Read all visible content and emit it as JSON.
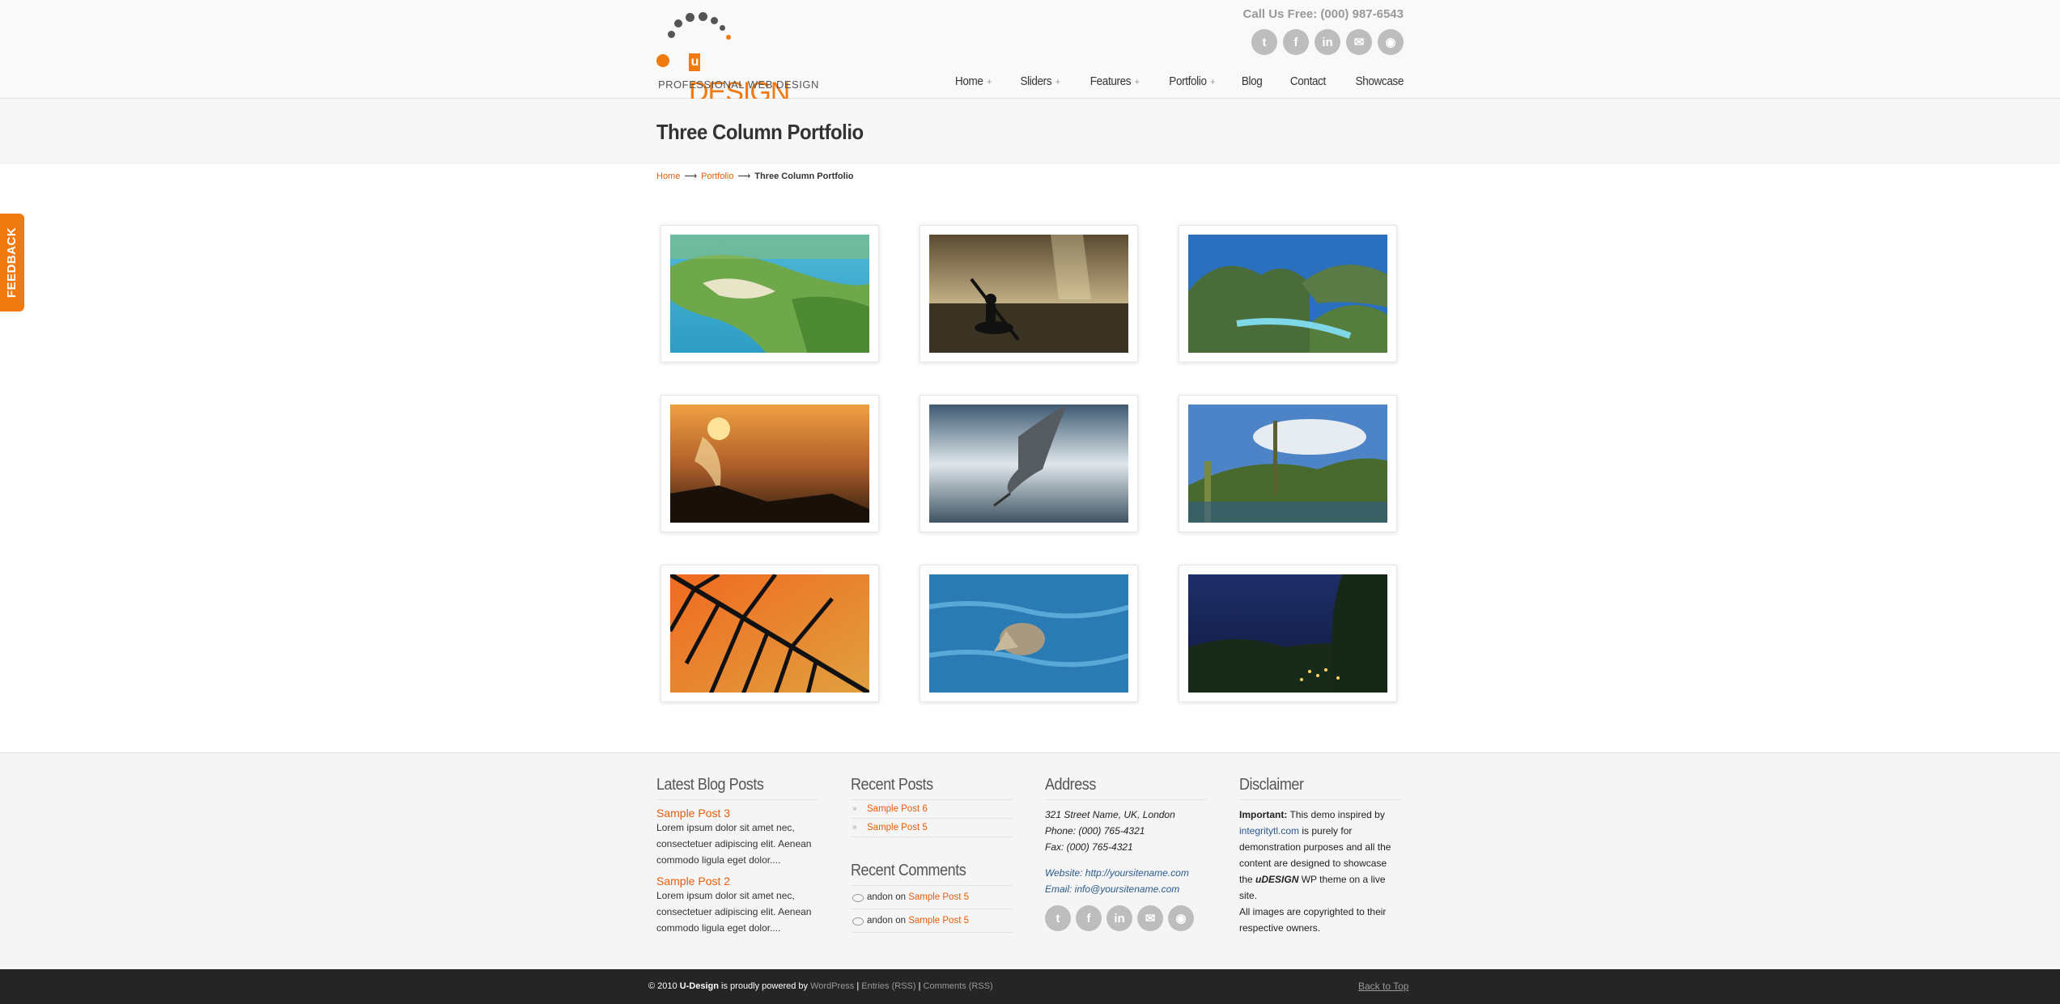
{
  "header": {
    "logo_text": "DESIGN",
    "logo_u": "u",
    "logo_tagline": "PROFESSIONAL WEB DESIGN",
    "call_us": "Call Us Free: (000) 987-6543",
    "social_icons": [
      "twitter-icon",
      "facebook-icon",
      "linkedin-icon",
      "email-icon",
      "rss-icon"
    ],
    "social_glyphs": [
      "t",
      "f",
      "in",
      "✉",
      "◉"
    ],
    "nav": [
      {
        "label": "Home",
        "has_sub": true
      },
      {
        "label": "Sliders",
        "has_sub": true
      },
      {
        "label": "Features",
        "has_sub": true
      },
      {
        "label": "Portfolio",
        "has_sub": true
      },
      {
        "label": "Blog",
        "has_sub": false
      },
      {
        "label": "Contact",
        "has_sub": false
      },
      {
        "label": "Showcase",
        "has_sub": false
      }
    ],
    "nav_plus": "+"
  },
  "page": {
    "title": "Three Column Portfolio",
    "breadcrumb": {
      "home": "Home",
      "portfolio": "Portfolio",
      "current": "Three Column Portfolio",
      "separator": "⟶"
    }
  },
  "feedback_tab": "FEEDBACK",
  "portfolio_items": [
    {
      "name": "island-aerial-1"
    },
    {
      "name": "kayaker-silhouette"
    },
    {
      "name": "bay-hills"
    },
    {
      "name": "sunset-splash"
    },
    {
      "name": "heron-flight"
    },
    {
      "name": "cactus-hills"
    },
    {
      "name": "palm-leaf-sunset"
    },
    {
      "name": "swimming-pelican"
    },
    {
      "name": "night-harbor"
    }
  ],
  "footer": {
    "latest_blog": {
      "title": "Latest Blog Posts",
      "posts": [
        {
          "title": "Sample Post 3",
          "excerpt": "Lorem ipsum dolor sit amet nec, consectetuer adipiscing elit. Aenean commodo ligula eget dolor...."
        },
        {
          "title": "Sample Post 2",
          "excerpt": "Lorem ipsum dolor sit amet nec, consectetuer adipiscing elit. Aenean commodo ligula eget dolor...."
        }
      ]
    },
    "recent_posts": {
      "title": "Recent Posts",
      "items": [
        "Sample Post 6",
        "Sample Post 5"
      ]
    },
    "recent_comments": {
      "title": "Recent Comments",
      "items": [
        {
          "author": "andon",
          "on": "on",
          "post": "Sample Post 5"
        },
        {
          "author": "andon",
          "on": "on",
          "post": "Sample Post 5"
        }
      ]
    },
    "address": {
      "title": "Address",
      "line1": "321 Street Name, UK, London",
      "phone": "Phone: (000) 765-4321",
      "fax": "Fax: (000) 765-4321",
      "website": "Website: http://yoursitename.com",
      "email": "Email: info@yoursitename.com"
    },
    "disclaimer": {
      "title": "Disclaimer",
      "important": "Important:",
      "text1": " This demo inspired by ",
      "link": "integritytl.com",
      "text2": " is purely for demonstration purposes and all the content are designed to showcase the ",
      "brand": "uDESIGN",
      "text3": " WP theme on a live site.",
      "text4": "All images are copyrighted to their respective owners."
    }
  },
  "bottom": {
    "copy_prefix": "© 2010 ",
    "brand": "U-Design",
    "powered": " is proudly powered by ",
    "wordpress": "WordPress",
    "sep": " | ",
    "entries": "Entries (RSS)",
    "comments": "Comments (RSS)",
    "back_to_top": "Back to Top"
  },
  "colors": {
    "accent": "#f07a10",
    "link_orange": "#e85c0b",
    "link_blue": "#2a5a8c",
    "bottom_bar": "#252525"
  }
}
